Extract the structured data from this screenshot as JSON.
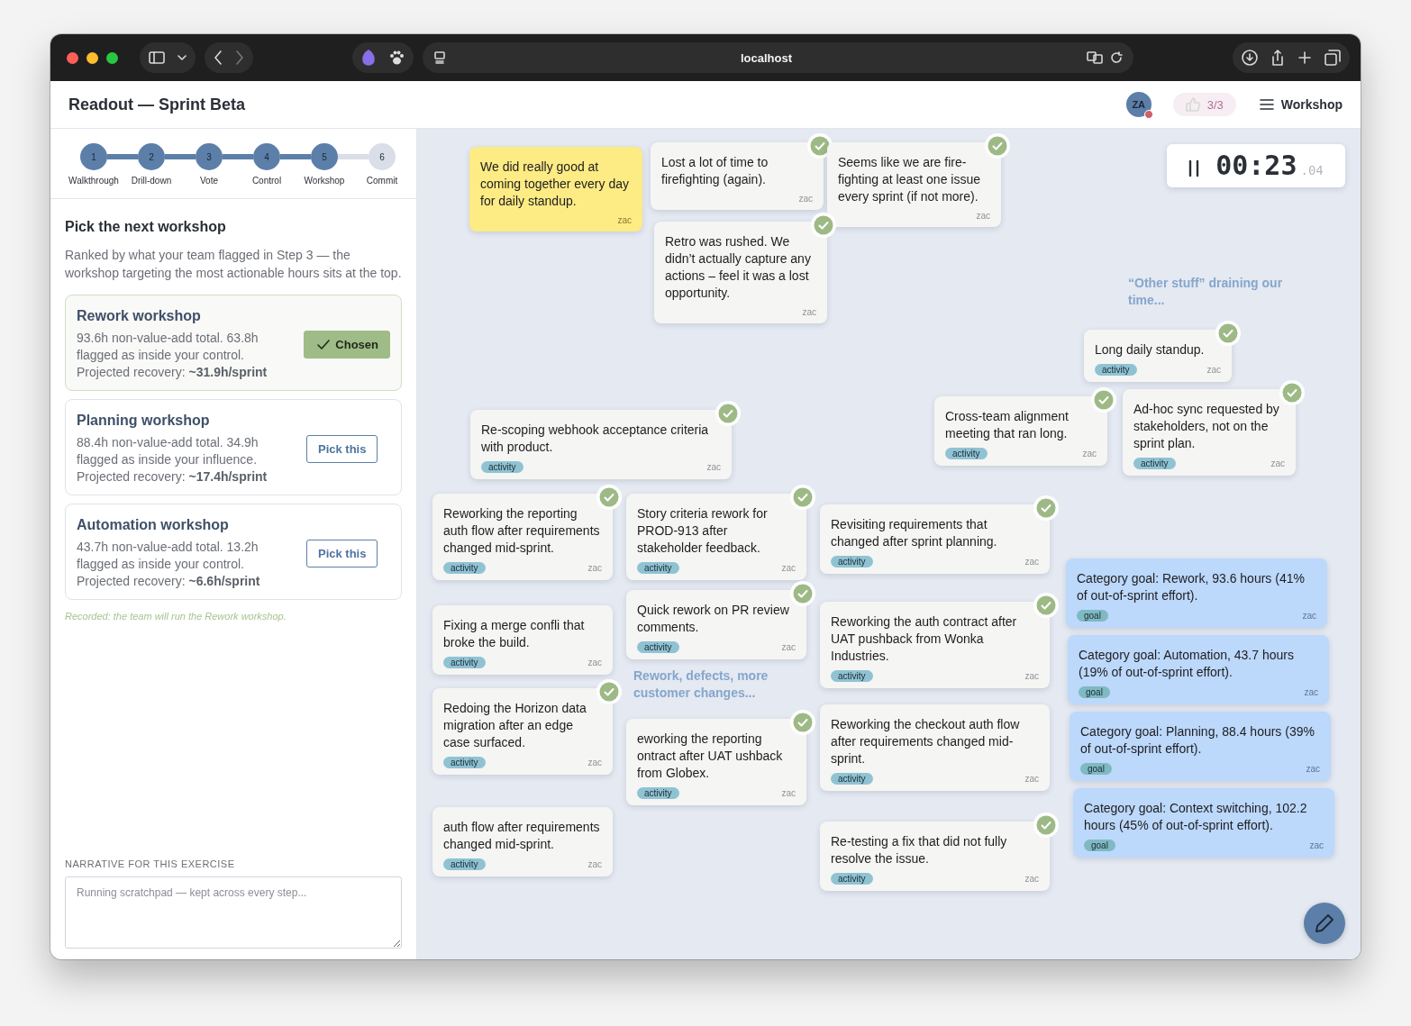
{
  "window": {
    "url": "localhost"
  },
  "header": {
    "title": "Readout — Sprint Beta",
    "avatar": "ZA",
    "likes": "3/3",
    "menu_label": "Workshop"
  },
  "steps": [
    {
      "number": "1",
      "label": "Walkthrough",
      "completed": true
    },
    {
      "number": "2",
      "label": "Drill-down",
      "completed": true
    },
    {
      "number": "3",
      "label": "Vote",
      "completed": true
    },
    {
      "number": "4",
      "label": "Control",
      "completed": true
    },
    {
      "number": "5",
      "label": "Workshop",
      "completed": true
    },
    {
      "number": "6",
      "label": "Commit",
      "completed": false
    }
  ],
  "panel": {
    "heading": "Pick the next workshop",
    "intro": "Ranked by what your team flagged in Step 3 — the workshop targeting the most actionable hours sits at the top."
  },
  "workshops": [
    {
      "title": "Rework workshop",
      "summary": "93.6h non-value-add total. 63.8h flagged as inside your control. Projected recovery: **~31.9h/sprint**",
      "button": "Chosen",
      "selected": true
    },
    {
      "title": "Planning workshop",
      "summary": "88.4h non-value-add total. 34.9h flagged as inside your influence. Projected recovery: **~17.4h/sprint**",
      "button": "Pick this",
      "selected": false
    },
    {
      "title": "Automation workshop",
      "summary": "43.7h non-value-add total. 13.2h flagged as inside your control. Projected recovery: **~6.6h/sprint**",
      "button": "Pick this",
      "selected": false
    }
  ],
  "recorded_note": "Recorded: the team will run the Rework workshop.",
  "narrative": {
    "label": "NARRATIVE FOR THIS EXERCISE",
    "placeholder": "Running scratchpad — kept across every step..."
  },
  "timer": {
    "value": "00:23",
    "fraction": ".04",
    "running": true
  },
  "board": {
    "headings": [
      "“Other stuff” draining our time...",
      "Rework, defects, more customer changes..."
    ],
    "notes": [
      {
        "kind": "highlight",
        "text": "We did really good at coming together every day for daily standup.",
        "author": "zac",
        "checked": false
      },
      {
        "kind": "note",
        "text": "Lost a lot of time to firefighting (again).",
        "author": "zac",
        "checked": true
      },
      {
        "kind": "note",
        "text": "Seems like we are fire-fighting at least one issue every sprint (if not more).",
        "author": "zac",
        "checked": true
      },
      {
        "kind": "note",
        "text": "Retro was rushed. We didn’t actually capture any actions – feel it was a lost opportunity.",
        "author": "zac",
        "checked": true
      },
      {
        "kind": "note",
        "text": "Long daily standup.",
        "tag": "activity",
        "author": "zac",
        "checked": true
      },
      {
        "kind": "note",
        "text": "Re-scoping webhook acceptance criteria with product.",
        "tag": "activity",
        "author": "zac",
        "checked": true
      },
      {
        "kind": "note",
        "text": "Cross-team alignment meeting that ran long.",
        "tag": "activity",
        "author": "zac",
        "checked": true
      },
      {
        "kind": "note",
        "text": "Ad-hoc sync requested by stakeholders, not on the sprint plan.",
        "tag": "activity",
        "author": "zac",
        "checked": true
      },
      {
        "kind": "note",
        "text": "Reworking the reporting auth flow after requirements changed mid-sprint.",
        "tag": "activity",
        "author": "zac",
        "checked": true
      },
      {
        "kind": "note",
        "text": "Story criteria rework for PROD-913 after stakeholder feedback.",
        "tag": "activity",
        "author": "zac",
        "checked": true
      },
      {
        "kind": "note",
        "text": "Revisiting requirements that changed after sprint planning.",
        "tag": "activity",
        "author": "zac",
        "checked": true
      },
      {
        "kind": "note",
        "text": "Fixing a merge confli that broke the build.",
        "tag": "activity",
        "author": "zac",
        "checked": false
      },
      {
        "kind": "note",
        "text": "Quick rework on PR review comments.",
        "tag": "activity",
        "author": "zac",
        "checked": true
      },
      {
        "kind": "note",
        "text": "Reworking the auth contract after UAT pushback from Wonka Industries.",
        "tag": "activity",
        "author": "zac",
        "checked": true
      },
      {
        "kind": "note",
        "text": "Redoing the Horizon data migration after an edge case surfaced.",
        "tag": "activity",
        "author": "zac",
        "checked": true
      },
      {
        "kind": "note",
        "text": "eworking the reporting ontract after UAT ushback from Globex.",
        "tag": "activity",
        "author": "zac",
        "checked": true
      },
      {
        "kind": "note",
        "text": "Reworking the checkout auth flow after requirements changed mid-sprint.",
        "tag": "activity",
        "author": "zac",
        "checked": false
      },
      {
        "kind": "note",
        "text": "auth flow after requirements changed mid-sprint.",
        "tag": "activity",
        "author": "zac",
        "checked": false
      },
      {
        "kind": "note",
        "text": "Re-testing a fix that did not fully resolve the issue.",
        "tag": "activity",
        "author": "zac",
        "checked": true
      },
      {
        "kind": "goal",
        "text": "Category goal: Rework, 93.6 hours (41% of out-of-sprint effort).",
        "tag": "goal",
        "author": "zac",
        "checked": false
      },
      {
        "kind": "goal",
        "text": "Category goal: Automation, 43.7 hours (19% of out-of-sprint effort).",
        "tag": "goal",
        "author": "zac",
        "checked": false
      },
      {
        "kind": "goal",
        "text": "Category goal: Planning, 88.4 hours (39% of out-of-sprint effort).",
        "tag": "goal",
        "author": "zac",
        "checked": false
      },
      {
        "kind": "goal",
        "text": "Category goal: Context switching, 102.2 hours (45% of out-of-sprint effort).",
        "tag": "goal",
        "author": "zac",
        "checked": false
      }
    ]
  }
}
